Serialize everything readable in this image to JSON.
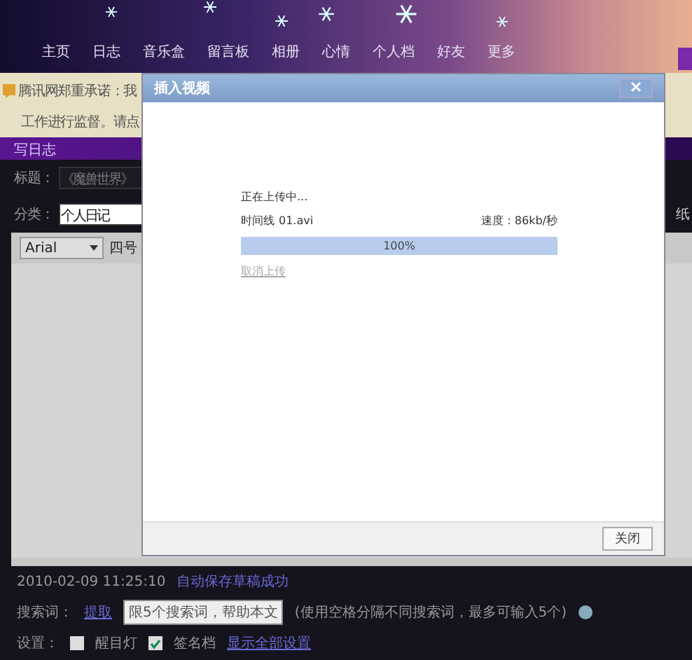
{
  "nav": {
    "items": [
      "主页",
      "日志",
      "音乐盒",
      "留言板",
      "相册",
      "心情",
      "个人档",
      "好友",
      "更多"
    ]
  },
  "notice": {
    "lines": [
      "腾讯网郑重承诺：我",
      "工作进行监督。请点"
    ]
  },
  "section_title": "写日志",
  "form": {
    "title_label": "标题：",
    "title_placeholder": "《魔兽世界》",
    "category_label": "分类：",
    "category_value": "个人日记",
    "right_text": "纸"
  },
  "toolbar": {
    "font": "Arial",
    "size": "四号"
  },
  "status": {
    "saved": "2010-02-09 11:25:10",
    "saved_message": "自动保存草稿成功"
  },
  "tags": {
    "label": "搜索词：",
    "extract": "提取",
    "placeholder": "限5个搜索词，帮助本文",
    "hint": "(使用空格分隔不同搜索词，最多可输入5个)"
  },
  "settings": {
    "label": "设置：",
    "options": [
      {
        "label": "醒目灯",
        "checked": false
      },
      {
        "label": "签名档",
        "checked": true
      }
    ],
    "link": "显示全部设置"
  },
  "dialog": {
    "title": "插入视频",
    "status": "正在上传中...",
    "file_label": "时间线",
    "file_name": "01.avi",
    "speed": "速度：86kb/秒",
    "progress": {
      "level": 1,
      "reading": "100%"
    },
    "cancel": "取消上传",
    "close_button": "关闭"
  }
}
